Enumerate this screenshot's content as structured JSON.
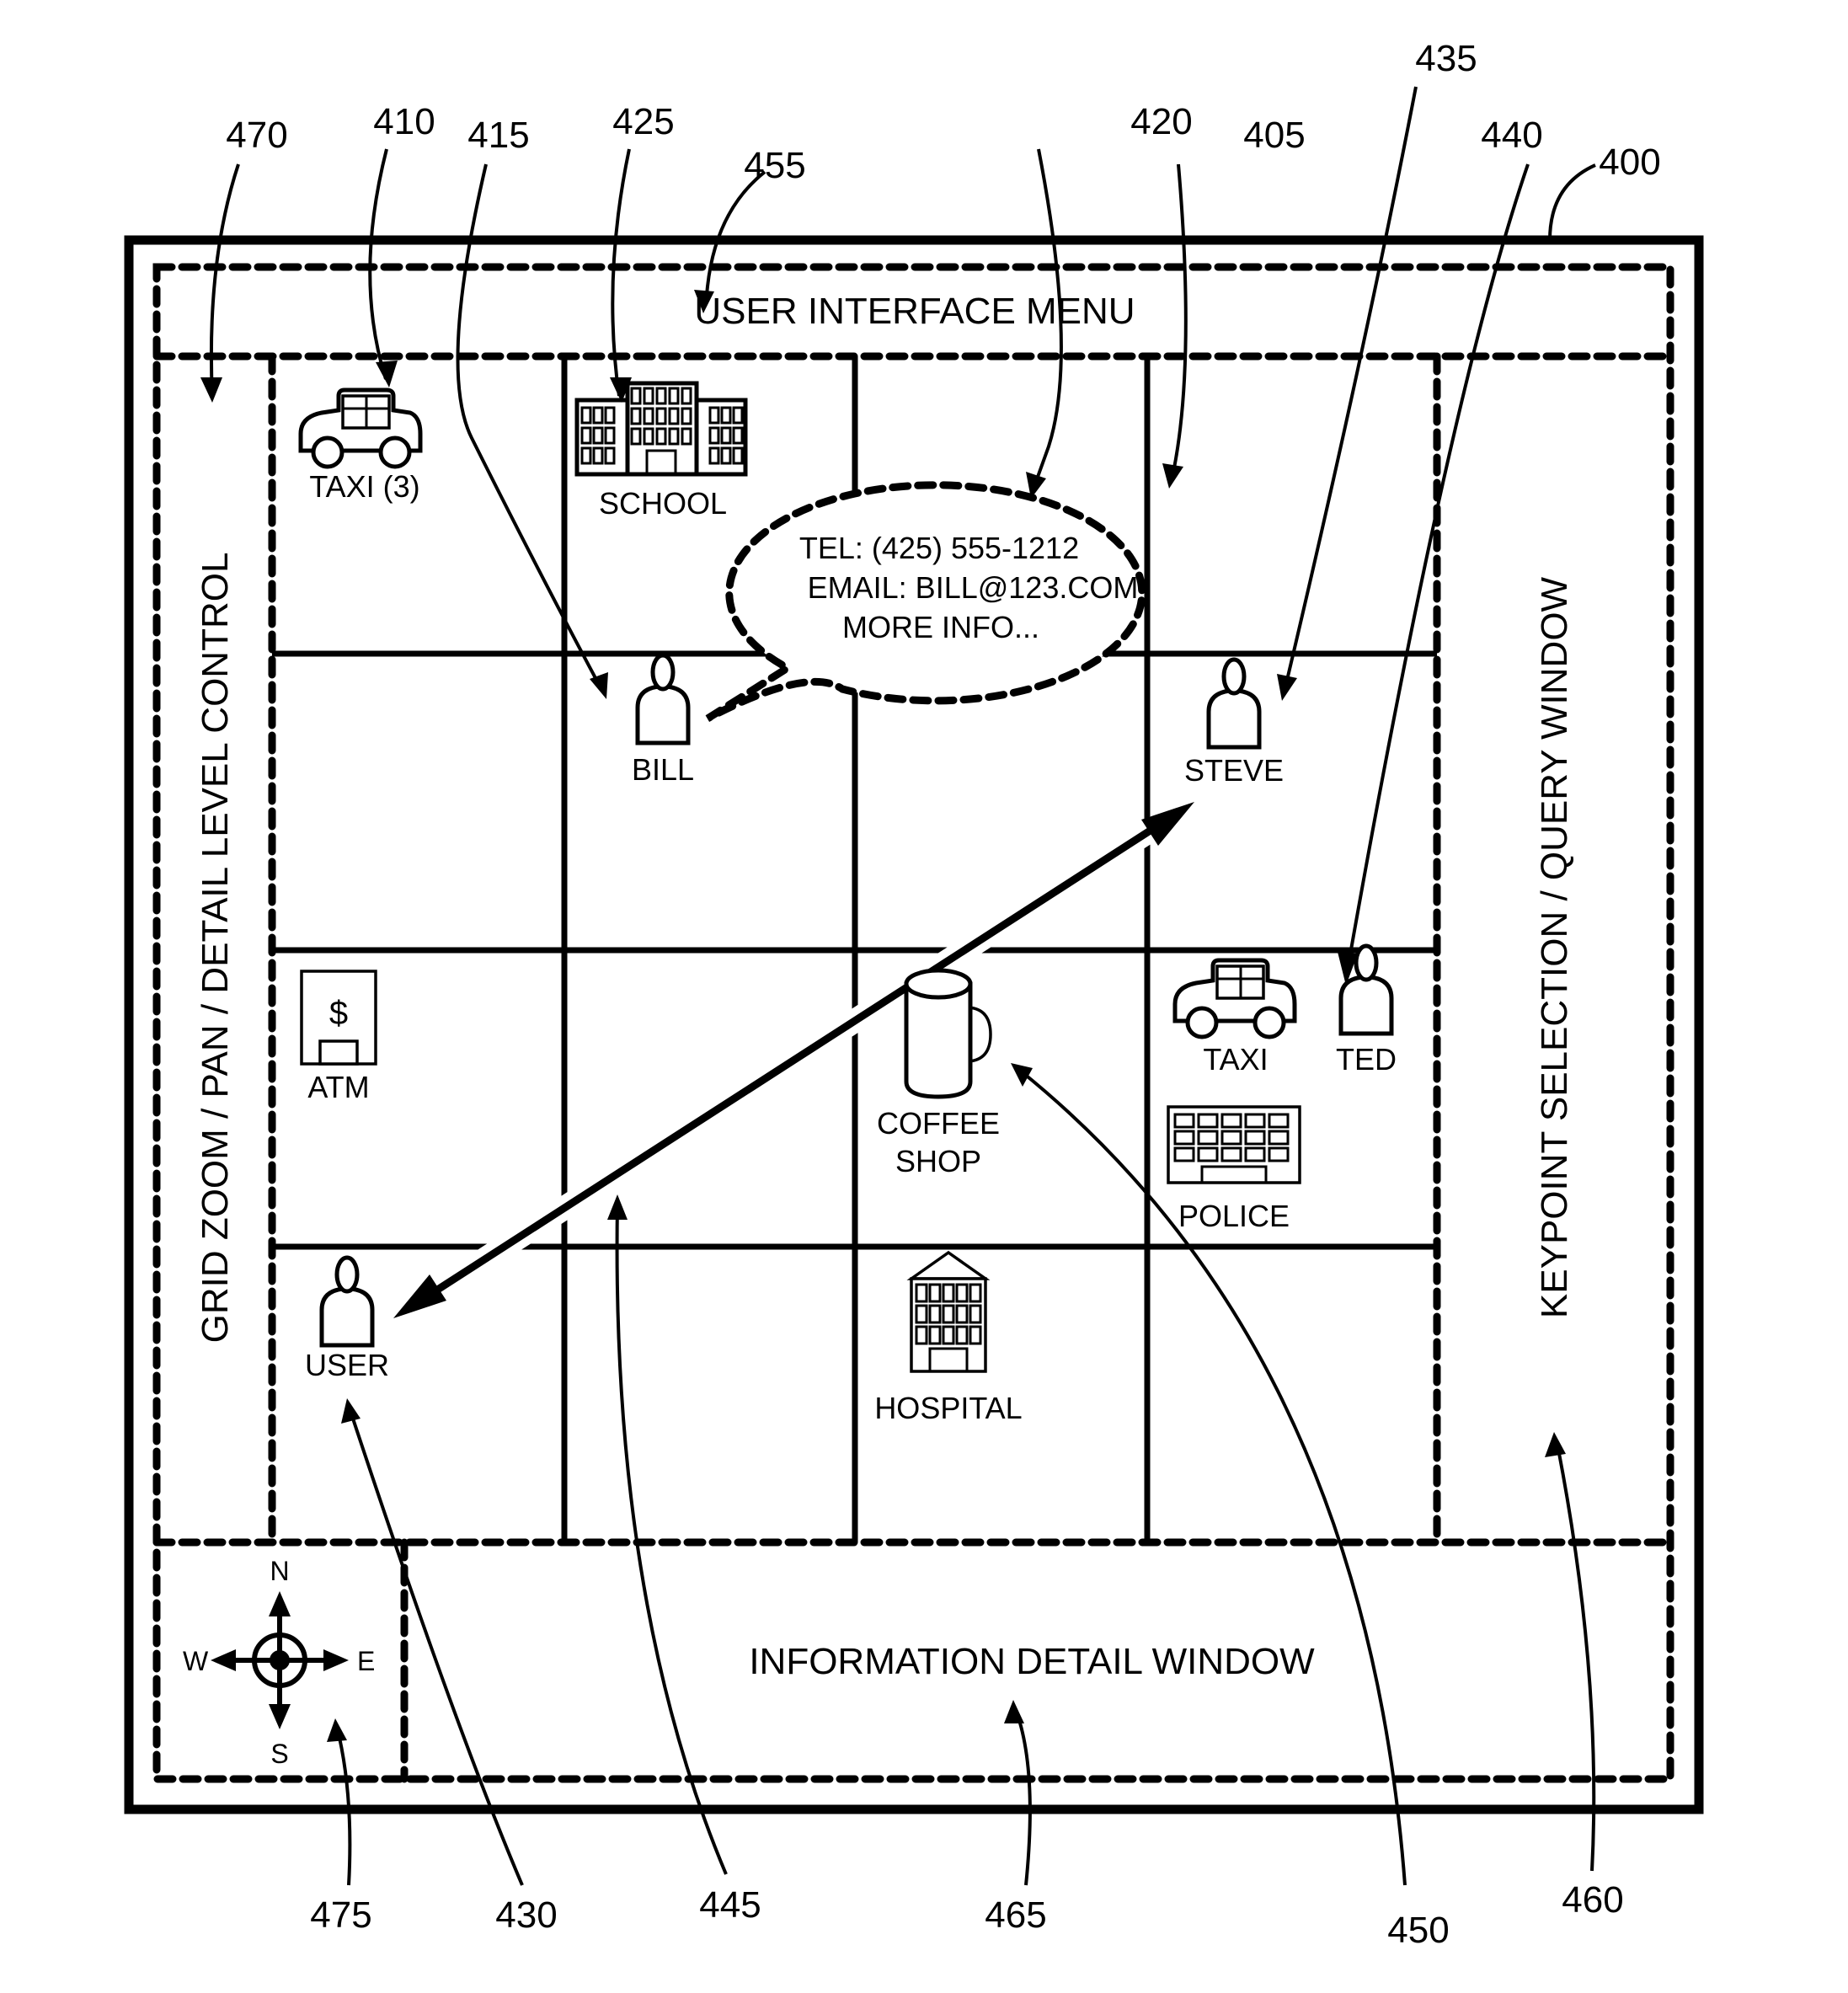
{
  "figure": {
    "ref_numerals": {
      "device": "400",
      "map_grid": "405",
      "taxi_group": "410",
      "bill_marker": "415",
      "info_bubble": "420",
      "school": "425",
      "user_marker": "430",
      "steve_marker": "435",
      "ted_marker": "440",
      "route_arrow": "445",
      "coffee_shop": "450",
      "ui_menu": "455",
      "query_window": "460",
      "detail_window": "465",
      "zoom_control": "470",
      "compass": "475"
    },
    "panels": {
      "menu": "USER INTERFACE MENU",
      "left_control": "GRID ZOOM / PAN  / DETAIL LEVEL CONTROL",
      "right_query": "KEYPOINT SELECTION / QUERY WINDOW",
      "detail": "INFORMATION DETAIL WINDOW"
    },
    "map_items": {
      "taxi_group": {
        "label": "TAXI (3)",
        "icon": "taxi-icon"
      },
      "school": {
        "label": "SCHOOL",
        "icon": "school-building-icon"
      },
      "bill": {
        "label": "BILL",
        "icon": "person-icon"
      },
      "steve": {
        "label": "STEVE",
        "icon": "person-icon"
      },
      "atm": {
        "label": "ATM",
        "icon": "atm-icon",
        "glyph": "$"
      },
      "coffee_shop": {
        "label_line1": "COFFEE",
        "label_line2": "SHOP",
        "icon": "coffee-mug-icon"
      },
      "taxi": {
        "label": "TAXI",
        "icon": "taxi-icon"
      },
      "ted": {
        "label": "TED",
        "icon": "person-icon"
      },
      "police": {
        "label": "POLICE",
        "icon": "police-building-icon"
      },
      "user": {
        "label": "USER",
        "icon": "person-icon"
      },
      "hospital": {
        "label": "HOSPITAL",
        "icon": "hospital-building-icon"
      }
    },
    "info_bubble": {
      "tel": "TEL: (425) 555-1212",
      "email": "EMAIL: BILL@123.COM",
      "more": "MORE INFO..."
    },
    "compass": {
      "north": "N",
      "south": "S",
      "east": "E",
      "west": "W"
    }
  }
}
